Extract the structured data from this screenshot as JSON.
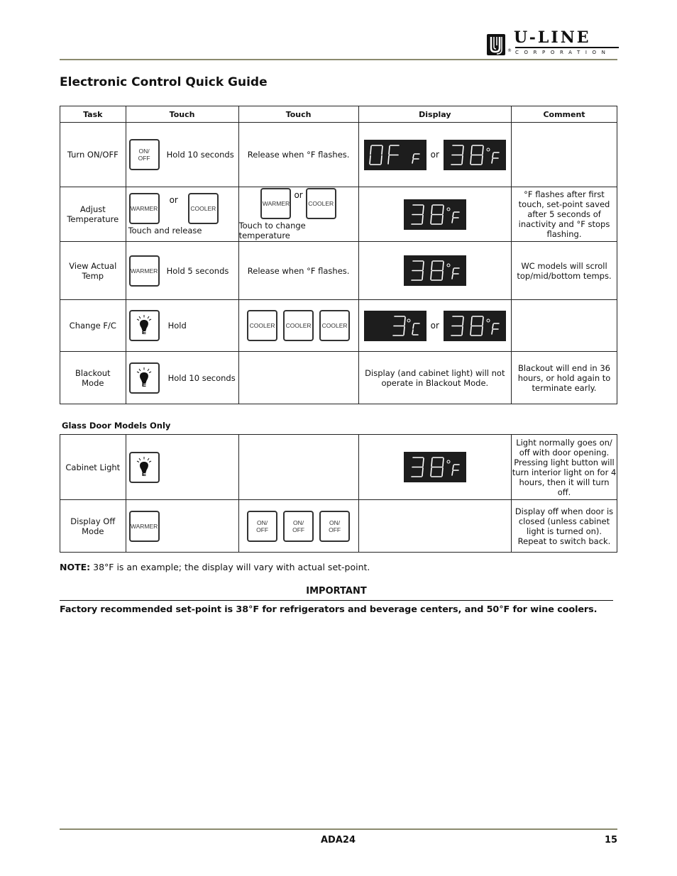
{
  "header": {
    "brand_name": "U-LINE",
    "brand_sub": "CORPORATION",
    "brand_reg": "®"
  },
  "page_title": "Electronic Control Quick Guide",
  "table": {
    "headers": [
      "Task",
      "Touch",
      "Touch",
      "Display",
      "Comment"
    ],
    "rows": [
      {
        "task": "Turn ON/OFF",
        "touch1_buttons": [
          "ON/\nOFF"
        ],
        "touch1_text": "Hold 10 seconds",
        "touch2_text": "Release when °F flashes.",
        "display_a": "OFF F",
        "display_or": "or",
        "display_b": "38°F",
        "comment": ""
      },
      {
        "task": "Adjust Temperature",
        "touch1_buttons": [
          "WARMER",
          "COOLER"
        ],
        "touch1_or": "or",
        "touch1_text": "Touch and release",
        "touch2_buttons": [
          "WARMER",
          "COOLER"
        ],
        "touch2_or": "or",
        "touch2_text": "Touch to change temperature",
        "display": "38°F",
        "comment": "°F flashes after first touch, set-point saved after 5 seconds of inactivity and °F stops flashing."
      },
      {
        "task": "View Actual Temp",
        "touch1_buttons": [
          "WARMER"
        ],
        "touch1_text": "Hold 5 seconds",
        "touch2_text": "Release when °F flashes.",
        "display": "38°F",
        "comment": "WC models will scroll top/mid/bottom temps."
      },
      {
        "task": "Change F/C",
        "touch1_icon": "light-bulb-icon",
        "touch1_text": "Hold",
        "touch2_buttons": [
          "COOLER",
          "COOLER",
          "COOLER"
        ],
        "display_a": "3°C",
        "display_or": "or",
        "display_b": "38°F",
        "comment": ""
      },
      {
        "task": "Blackout Mode",
        "touch1_icon": "light-bulb-icon",
        "touch1_text": "Hold 10 seconds",
        "touch2_text": "",
        "display_text": "Display (and cabinet light) will not operate in Blackout Mode.",
        "comment": "Blackout will end in 36 hours, or hold again to terminate early."
      }
    ]
  },
  "glass_door": {
    "subheading": "Glass Door Models Only",
    "rows": [
      {
        "task": "Cabinet Light",
        "touch1_icon": "light-bulb-icon",
        "display": "38°F",
        "comment": "Light normally goes on/ off with door opening. Pressing light button will turn interior light on for 4 hours, then it will turn off."
      },
      {
        "task": "Display Off Mode",
        "touch1_buttons": [
          "WARMER"
        ],
        "touch2_buttons": [
          "ON/\nOFF",
          "ON/\nOFF",
          "ON/\nOFF"
        ],
        "comment": "Display off when door is closed (unless cabinet light is turned on). Repeat to switch back."
      }
    ]
  },
  "note": {
    "label": "NOTE:",
    "text": " 38°F is an example; the display will vary with actual set-point."
  },
  "important": {
    "heading": "IMPORTANT",
    "text": "Factory recommended set-point is 38°F for refrigerators and beverage centers, and 50°F for wine coolers."
  },
  "footer": {
    "model": "ADA24",
    "page": "15"
  },
  "colors": {
    "rule": "#8b8a6e",
    "lcd_bg": "#1d1d1d",
    "lcd_segment": "#ffffff"
  }
}
